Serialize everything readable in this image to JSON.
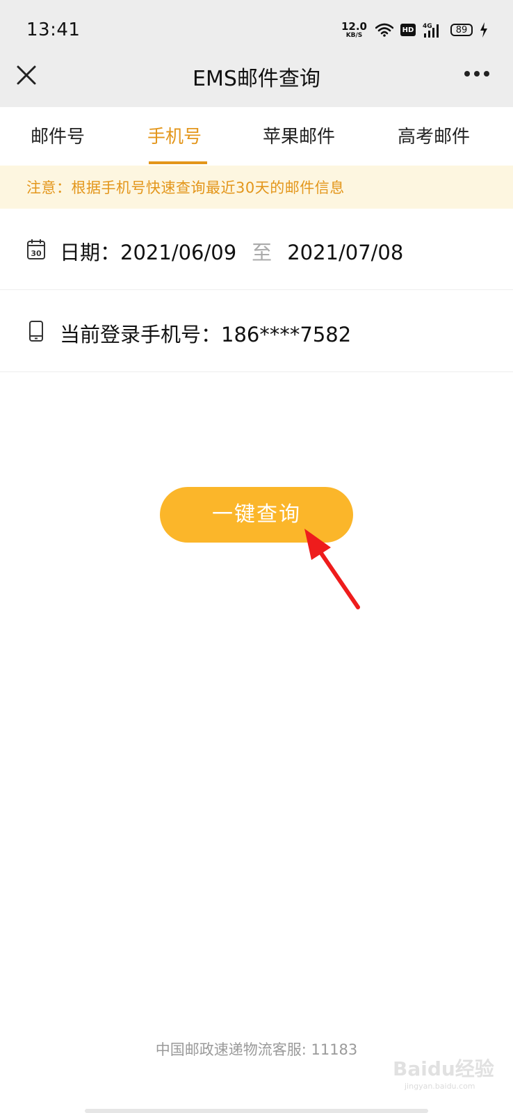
{
  "status_bar": {
    "time": "13:41",
    "net_speed_value": "12.0",
    "net_speed_unit": "KB/S",
    "hd_label": "HD",
    "network_type": "4G",
    "battery": "89"
  },
  "nav": {
    "title": "EMS邮件查询",
    "close_icon": "close-icon",
    "more_icon": "more-icon"
  },
  "tabs": [
    {
      "label": "邮件号",
      "active": false
    },
    {
      "label": "手机号",
      "active": true
    },
    {
      "label": "苹果邮件",
      "active": false
    },
    {
      "label": "高考邮件",
      "active": false
    }
  ],
  "notice": {
    "text": "注意：根据手机号快速查询最近30天的邮件信息"
  },
  "date_row": {
    "icon": "calendar-icon",
    "icon_day": "30",
    "label": "日期：",
    "start": "2021/06/09",
    "separator": "至",
    "end": "2021/07/08"
  },
  "phone_row": {
    "icon": "phone-icon",
    "label": "当前登录手机号：",
    "value": "186****7582"
  },
  "query_button": {
    "label": "一键查询"
  },
  "footer": {
    "text": "中国邮政速递物流客服: 11183"
  },
  "watermark": {
    "text": "Baidu经验",
    "url_text": "jingyan.baidu.com"
  },
  "colors": {
    "accent": "#e3961b",
    "button": "#fbb62a",
    "notice_bg": "#fdf6e0",
    "topbar_bg": "#ededed",
    "annotation_arrow": "#ee1c1c"
  }
}
